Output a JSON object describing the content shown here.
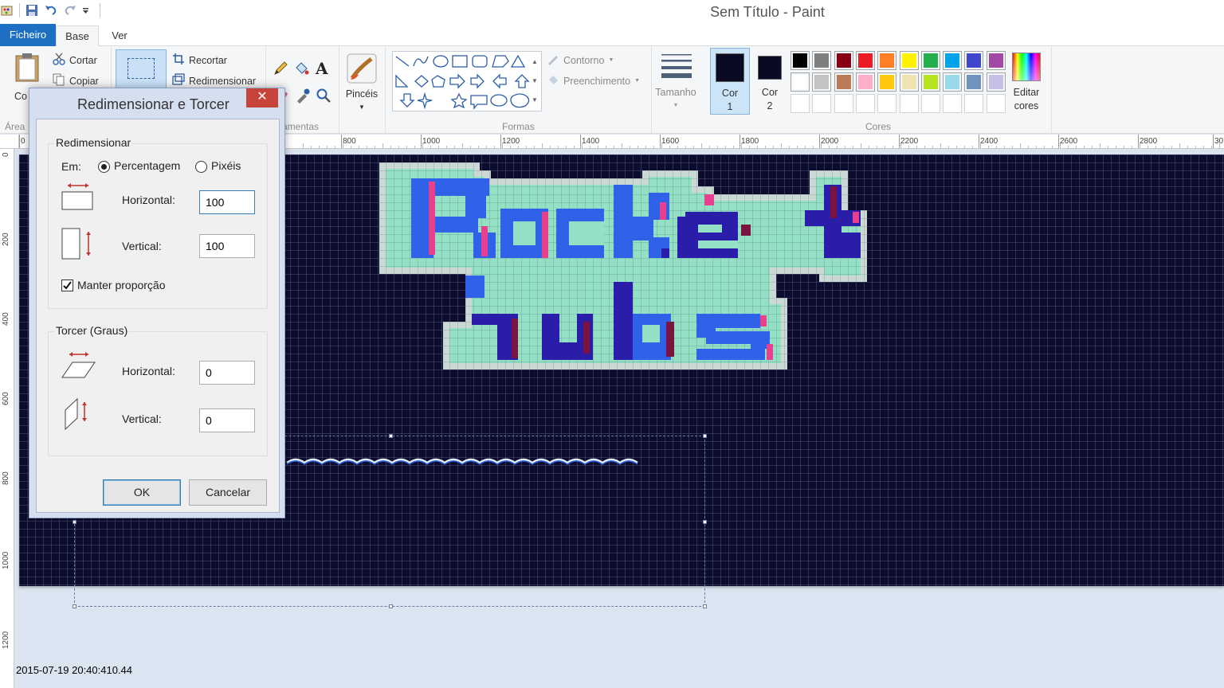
{
  "window": {
    "title": "Sem Título - Paint"
  },
  "tabs": {
    "file": "Ficheiro",
    "home": "Base",
    "view": "Ver"
  },
  "ribbon": {
    "clipboard": {
      "paste_partial": "Co",
      "cut": "Cortar",
      "copy": "Copiar",
      "group_partial": "Área"
    },
    "image": {
      "crop": "Recortar",
      "resize": "Redimensionar"
    },
    "tools": {
      "group_partial": "ramentas"
    },
    "brushes": {
      "label": "Pincéis"
    },
    "shapes": {
      "outline": "Contorno",
      "fill": "Preenchimento",
      "group": "Formas"
    },
    "size": {
      "label": "Tamanho"
    },
    "color1": {
      "line1": "Cor",
      "line2": "1",
      "color": "#0a0a24"
    },
    "color2": {
      "line1": "Cor",
      "line2": "2",
      "color": "#0a0a24"
    },
    "colors": {
      "group": "Cores",
      "row1": [
        "#000000",
        "#7f7f7f",
        "#880015",
        "#ed1c24",
        "#ff7f27",
        "#fff200",
        "#22b14c",
        "#00a2e8",
        "#3f48cc",
        "#a349a4"
      ],
      "row2": [
        "#ffffff",
        "#c3c3c3",
        "#b97a57",
        "#ffaec9",
        "#ffc90e",
        "#efe4b0",
        "#b5e61d",
        "#99d9ea",
        "#7092be",
        "#c8bfe7"
      ]
    },
    "edit_colors": {
      "line1": "Editar",
      "line2": "cores"
    }
  },
  "ruler": {
    "h_ticks": [
      "0",
      "800",
      "1000",
      "1200",
      "1400",
      "1600",
      "1800",
      "2000",
      "2200",
      "2400",
      "2600",
      "2800",
      "30"
    ],
    "v_ticks": [
      "0",
      "200",
      "400",
      "600",
      "800",
      "1000",
      "1200"
    ]
  },
  "canvas": {
    "logo_line1": "Rocket",
    "logo_line2": "Tubs"
  },
  "dialog": {
    "title": "Redimensionar e Torcer",
    "close": "✕",
    "resize": {
      "legend": "Redimensionar",
      "by_label": "Em:",
      "percent": "Percentagem",
      "pixels": "Pixéis",
      "horizontal_label": "Horizontal:",
      "horizontal_value": "100",
      "vertical_label": "Vertical:",
      "vertical_value": "100",
      "keep_ratio": "Manter proporção"
    },
    "skew": {
      "legend": "Torcer (Graus)",
      "horizontal_label": "Horizontal:",
      "horizontal_value": "0",
      "vertical_label": "Vertical:",
      "vertical_value": "0"
    },
    "ok": "OK",
    "cancel": "Cancelar"
  },
  "status": {
    "timestamp": "2015-07-19 20:40:410.44"
  }
}
